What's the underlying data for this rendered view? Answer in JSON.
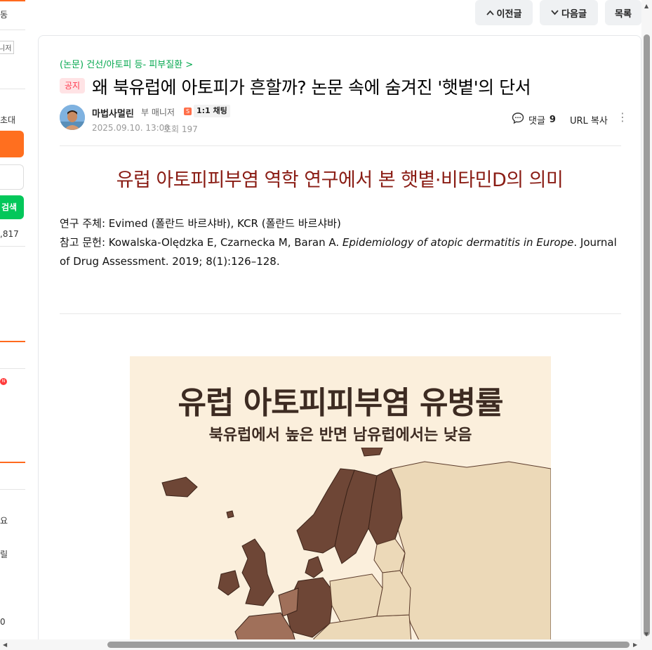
{
  "left_sidebar": {
    "text_1": "동",
    "tag": "니저",
    "text_invite": "초대",
    "search_label": "검색",
    "count": ",817",
    "badge": "N",
    "text_a": "요",
    "text_b": "릴",
    "text_c": "0"
  },
  "nav": {
    "prev_label": "이전글",
    "next_label": "다음글",
    "list_label": "목록"
  },
  "post": {
    "breadcrumb": "(논문) 건선/아토피 등- 피부질환 >",
    "notice_badge": "공지",
    "title": "왜 북유럽에 아토피가 흔할까? 논문 속에 숨겨진 '햇볕'의 단서",
    "author": "마법사멀린",
    "author_role": "부 매니저",
    "chat_label": "1:1 채팅",
    "date": "2025.09.10. 13:00",
    "views": "조회 197",
    "comment_label": "댓글",
    "comment_count": "9",
    "url_copy": "URL 복사"
  },
  "article": {
    "heading": "유럽 아토피피부염 역학 연구에서 본 햇볕·비타민D의 의미",
    "research_lead": "연구 주체: Evimed (폴란드 바르샤바), KCR (폴란드 바르샤바)",
    "ref_prefix": "참고 문헌: Kowalska-Olędzka E, Czarnecka M, Baran A. ",
    "ref_title": "Epidemiology of atopic dermatitis in Europe",
    "ref_suffix": ". Journal",
    "ref_line2": "of Drug Assessment. 2019; 8(1):126–128."
  },
  "infographic": {
    "title": "유럽 아토피피부염 유병률",
    "subtitle": "북유럽에서 높은 반면 남유럽에서는 낮음",
    "colors": {
      "background": "#fbefdc",
      "high": "#6e4636",
      "medium": "#a0705a",
      "low": "#ecd9b8",
      "sea": "#fbefdc"
    }
  },
  "colors": {
    "accent_green": "#03c75a",
    "accent_orange": "#ff6f1f",
    "heading_red": "#8a1c14"
  }
}
